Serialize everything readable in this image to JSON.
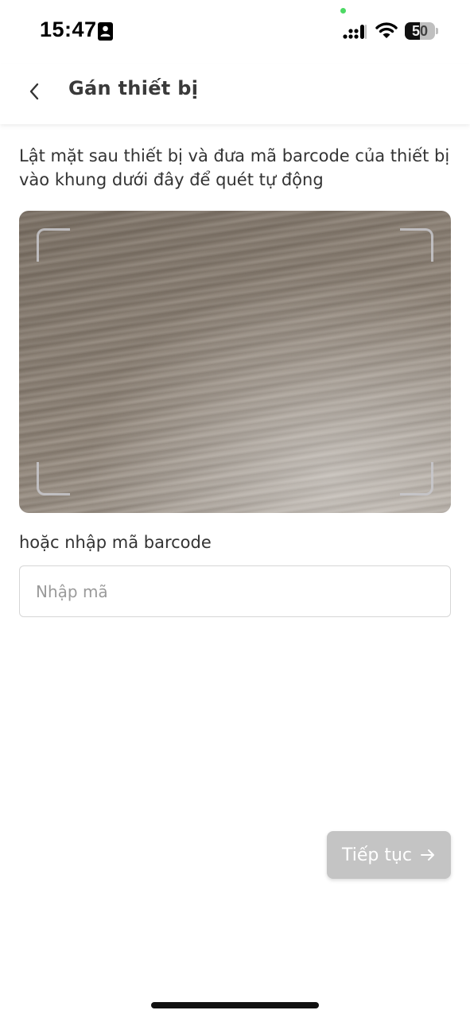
{
  "status_bar": {
    "time": "15:47",
    "battery_level": "50",
    "battery_fraction": 0.5,
    "icons": [
      "id-card-icon",
      "cellular-signal-icon",
      "wifi-icon",
      "battery-icon"
    ],
    "privacy_dot_color": "#4cd964"
  },
  "header": {
    "title": "Gán thiết bị",
    "back_icon": "chevron-left-icon"
  },
  "main": {
    "instruction": "Lật mặt sau thiết bị và đưa mã barcode của thiết bị vào khung dưới đây để quét tự động",
    "manual_label": "hoặc nhập mã barcode",
    "input": {
      "value": "",
      "placeholder": "Nhập mã"
    },
    "continue_button": {
      "label": "Tiếp tục",
      "icon": "arrow-right-icon",
      "enabled": false
    }
  },
  "colors": {
    "button_disabled": "#c4c4c4",
    "text_primary": "#333333",
    "input_border": "#d6d6d6"
  }
}
